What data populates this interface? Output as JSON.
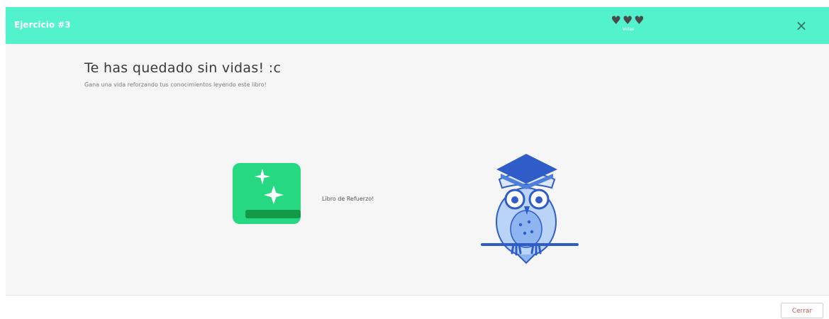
{
  "header": {
    "title": "Ejercicio #3",
    "hearts": "♥♥♥",
    "lives_label": "Vidas",
    "close_symbol": "×",
    "color": "#52f2cc"
  },
  "main": {
    "title": "Te has quedado sin vidas! :c",
    "subtitle": "Gana una vida reforzando tus conocimientos leyendo este libro!",
    "book_icon": "book-sparkle-icon",
    "book_color": "#27d883",
    "book_label": "Libro de Refuerzo!",
    "mascot_icon": "owl-graduate-icon"
  },
  "footer": {
    "close_button_label": "Cerrar"
  }
}
